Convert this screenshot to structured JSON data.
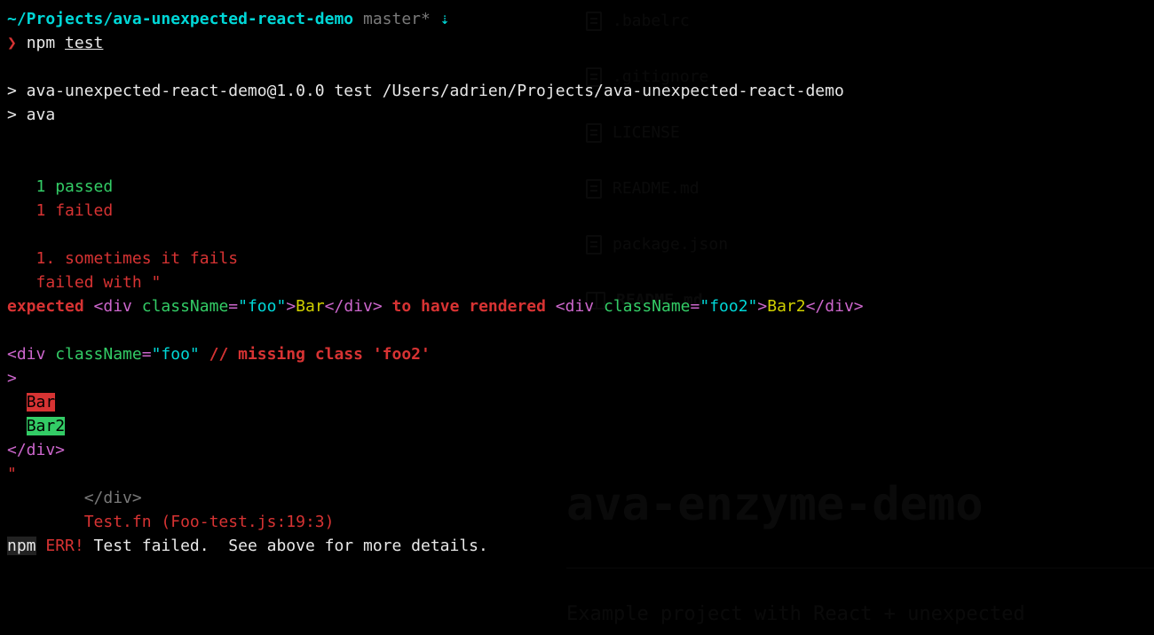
{
  "bg": {
    "files": [
      ".babelrc",
      ".gitignore",
      "LICENSE",
      "README.md",
      "package.json"
    ],
    "readme_label": "README.md",
    "title": "ava-enzyme-demo",
    "subtitle": "Example project with React + unexpected"
  },
  "prompt": {
    "path": "~/Projects/ava-unexpected-react-demo",
    "branch": "master",
    "dirty": "*",
    "arrow": "⇣",
    "indicator": "❯",
    "cmd_prefix": "npm ",
    "cmd_arg": "test"
  },
  "npm_lines": {
    "l1": "> ava-unexpected-react-demo@1.0.0 test /Users/adrien/Projects/ava-unexpected-react-demo",
    "l2": "> ava"
  },
  "results": {
    "passed_count": "1",
    "passed_label": " passed",
    "failed_count": "1",
    "failed_label": " failed"
  },
  "fail": {
    "title": "1. sometimes it fails",
    "failed_with": "failed with \"",
    "expected": "expected",
    "to_have_rendered": "to have rendered",
    "open_div": "<div",
    "classname_attr": " className",
    "eq": "=",
    "foo_val": "\"foo\"",
    "foo2_val": "\"foo2\"",
    "gt": ">",
    "bar_text": "Bar",
    "bar2_text": "Bar2",
    "close_div": "</div>",
    "comment": "// missing class 'foo2'",
    "lone_gt": ">",
    "bar_diff": "Bar",
    "bar2_diff": "Bar2",
    "close_quote": "\"",
    "stack_close": "</div>",
    "stack_loc": "Test.fn (Foo-test.js:19:3)"
  },
  "npm_err": {
    "npm": "npm",
    "err": " ERR! ",
    "msg": "Test failed.  See above for more details."
  }
}
